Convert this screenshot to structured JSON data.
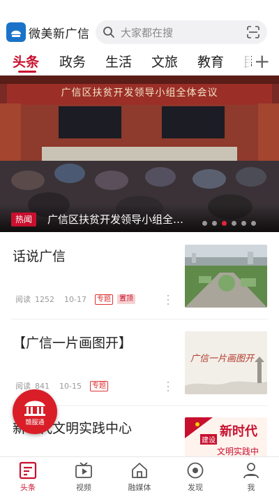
{
  "header": {
    "app_name": "微美新广信",
    "search_placeholder": "大家都在搜"
  },
  "tabs": [
    {
      "label": "头条",
      "active": true
    },
    {
      "label": "政务",
      "active": false
    },
    {
      "label": "生活",
      "active": false
    },
    {
      "label": "文旅",
      "active": false
    },
    {
      "label": "教育",
      "active": false
    },
    {
      "label": "民",
      "active": false
    }
  ],
  "banner": {
    "hall_sign": "广信区扶贫开发领导小组全体会议",
    "tag": "热闻",
    "title": "广信区扶贫开发领导小组全…",
    "dot_count": 6,
    "active_dot": 2
  },
  "news": [
    {
      "title": "话说广信",
      "read_label": "阅读",
      "read_count": "1252",
      "date": "10-17",
      "tags": [
        "专题",
        "置顶"
      ]
    },
    {
      "title": "【广信一片画图开】",
      "read_label": "阅读",
      "read_count": "841",
      "date": "10-15",
      "tags": [
        "专题"
      ]
    },
    {
      "title": "新时代文明实践中心",
      "thumb_text_1": "建设",
      "thumb_text_2": "新时代",
      "thumb_text_3": "文明实践中",
      "thumb_calligraphy": "广信一片画图开"
    }
  ],
  "float_button": {
    "label": "赣服通"
  },
  "bottom_nav": [
    {
      "label": "头条",
      "icon": "news-icon",
      "active": true
    },
    {
      "label": "视频",
      "icon": "video-icon",
      "active": false
    },
    {
      "label": "融媒体",
      "icon": "home-icon",
      "active": false
    },
    {
      "label": "发现",
      "icon": "discover-icon",
      "active": false
    },
    {
      "label": "我",
      "icon": "user-icon",
      "active": false
    }
  ],
  "colors": {
    "accent": "#c8102e",
    "logo_blue": "#1a73c8"
  }
}
